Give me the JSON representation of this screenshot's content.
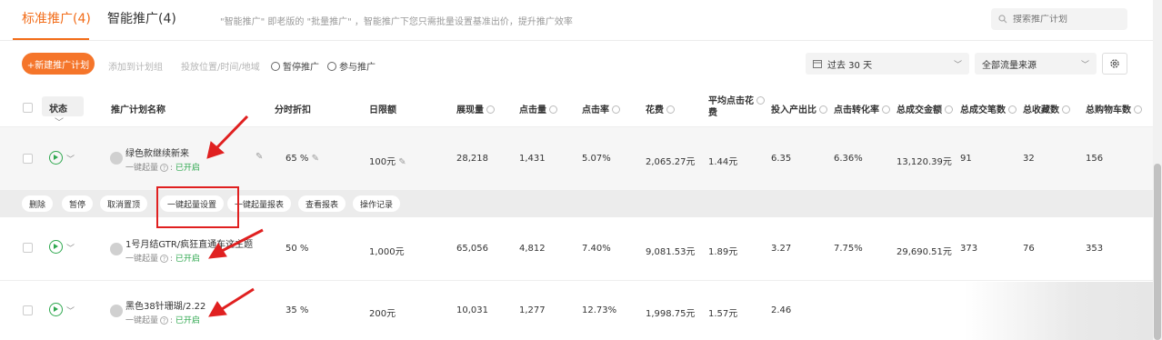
{
  "tabs": [
    {
      "label": "标准推广(4)",
      "active": true
    },
    {
      "label": "智能推广(4)",
      "active": false
    }
  ],
  "hint": "\"智能推广\" 即老版的 \"批量推广\" ，智能推广下您只需批量设置基准出价，提升推广效率",
  "search": {
    "placeholder": "搜索推广计划"
  },
  "toolbar": {
    "new_plan": "+新建推广计划",
    "add_to_group": "添加到计划组",
    "placement": "投放位置/时间/地域",
    "pause": "暂停推广",
    "join": "参与推广",
    "date_range": "过去 30 天",
    "traffic_source": "全部流量来源"
  },
  "columns": {
    "status": "状态",
    "plan_name": "推广计划名称",
    "discount": "分时折扣",
    "daily_limit": "日限额",
    "impressions": "展现量",
    "clicks": "点击量",
    "ctr": "点击率",
    "spend": "花费",
    "avg_cpc_1": "平均点击花",
    "avg_cpc_2": "费",
    "roi": "投入产出比",
    "cvr": "点击转化率",
    "gmv": "总成交金额",
    "orders": "总成交笔数",
    "favorites": "总收藏数",
    "carts": "总购物车数"
  },
  "sub_label": "一键起量",
  "sub_status": "已开启",
  "rows": [
    {
      "name": "绿色款继续新来",
      "discount": "65 %",
      "daily_limit": "100元",
      "impressions": "28,218",
      "clicks": "1,431",
      "ctr": "5.07%",
      "spend": "2,065.27元",
      "avg_cpc": "1.44元",
      "roi": "6.35",
      "cvr": "6.36%",
      "gmv": "13,120.39元",
      "orders": "91",
      "favorites": "32",
      "carts": "156"
    },
    {
      "name": "1号月结GTR/疯狂直通车这主题",
      "discount": "50 %",
      "daily_limit": "1,000元",
      "impressions": "65,056",
      "clicks": "4,812",
      "ctr": "7.40%",
      "spend": "9,081.53元",
      "avg_cpc": "1.89元",
      "roi": "3.27",
      "cvr": "7.75%",
      "gmv": "29,690.51元",
      "orders": "373",
      "favorites": "76",
      "carts": "353"
    },
    {
      "name": "黑色38针珊瑚/2.22",
      "discount": "35 %",
      "daily_limit": "200元",
      "impressions": "10,031",
      "clicks": "1,277",
      "ctr": "12.73%",
      "spend": "1,998.75元",
      "avg_cpc": "1.57元",
      "roi": "2.46",
      "cvr": "",
      "gmv": "",
      "orders": "",
      "favorites": "",
      "carts": ""
    }
  ],
  "row_actions": [
    "删除",
    "暂停",
    "取消置顶",
    "一键起量设置",
    "一键起量报表",
    "查看报表",
    "操作记录"
  ],
  "colors": {
    "accent": "#f26c18",
    "primary_button": "#f5752a",
    "status_on": "#2fa84f",
    "annotation": "#e02020"
  }
}
